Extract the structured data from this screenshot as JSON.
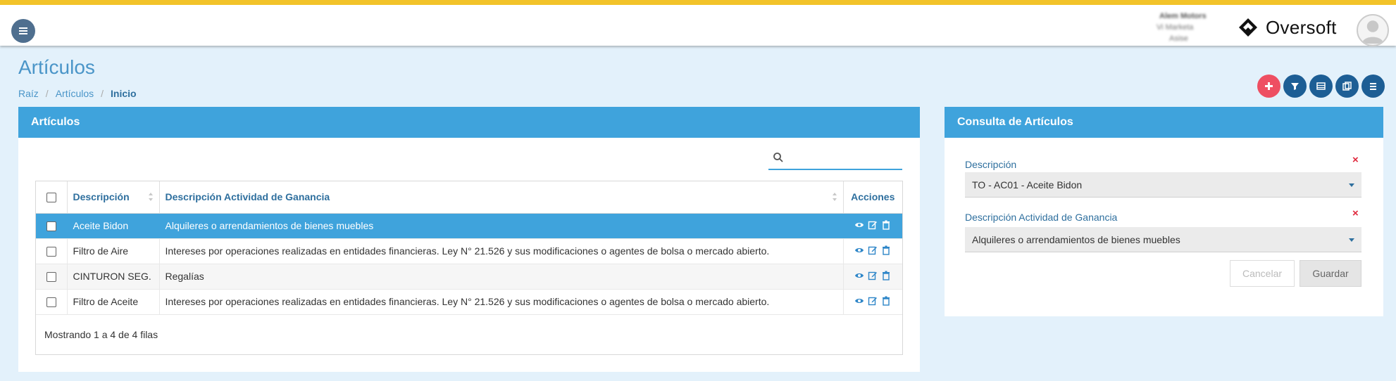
{
  "header": {
    "user_name": "Alem Motors",
    "user_line2": "Vi Marketa",
    "user_line3": "Asise",
    "brand": "Oversoft"
  },
  "page": {
    "title": "Artículos",
    "breadcrumb": [
      "Raíz",
      "Artículos",
      "Inicio"
    ]
  },
  "left_panel": {
    "title": "Artículos",
    "search_placeholder": "",
    "columns": [
      "Descripción",
      "Descripción Actividad de Ganancia",
      "Acciones"
    ],
    "rows": [
      {
        "descripcion": "Aceite Bidon",
        "actividad": "Alquileres o arrendamientos de bienes muebles"
      },
      {
        "descripcion": "Filtro de Aire",
        "actividad": "Intereses por operaciones realizadas en entidades financieras. Ley N° 21.526 y sus modificaciones o agentes de bolsa o mercado abierto."
      },
      {
        "descripcion": "CINTURON SEG.",
        "actividad": "Regalías"
      },
      {
        "descripcion": "Filtro de Aceite",
        "actividad": "Intereses por operaciones realizadas en entidades financieras. Ley N° 21.526 y sus modificaciones o agentes de bolsa o mercado abierto."
      }
    ],
    "footer": "Mostrando 1 a 4 de 4 filas"
  },
  "right_panel": {
    "title": "Consulta de Artículos",
    "field1_label": "Descripción",
    "field1_value": "TO - AC01 - Aceite Bidon",
    "field2_label": "Descripción Actividad de Ganancia",
    "field2_value": "Alquileres o arrendamientos de bienes muebles",
    "cancel_label": "Cancelar",
    "save_label": "Guardar"
  },
  "colors": {
    "accent": "#3fa3dc",
    "top_border": "#f2c32a",
    "action_btn": "#1d5e95",
    "add_btn": "#ee4f62",
    "clear_x": "#e0283c"
  }
}
